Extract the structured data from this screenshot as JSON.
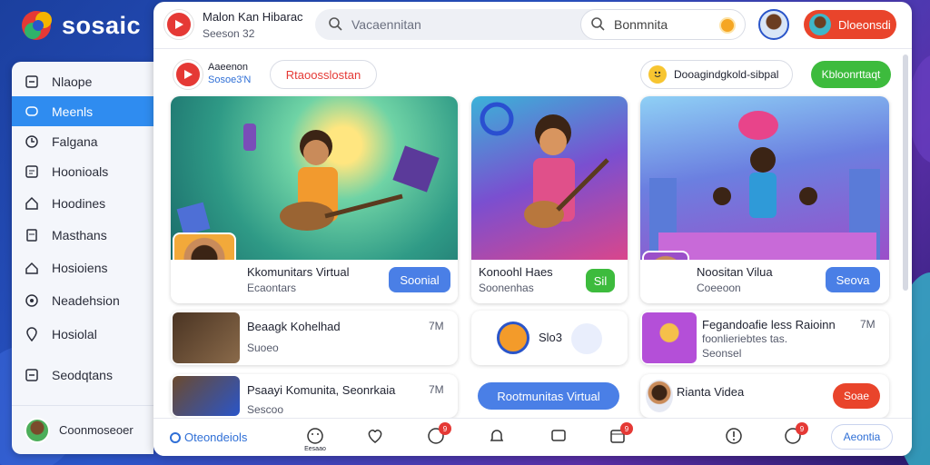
{
  "brand": {
    "name": "sosaic"
  },
  "sidebar": {
    "items": [
      {
        "label": "Nlaope",
        "icon": "inbox-icon"
      },
      {
        "label": "Meenls",
        "icon": "chat-bubble-icon"
      },
      {
        "label": "Falgana",
        "icon": "clock-icon"
      },
      {
        "label": "Hoonioals",
        "icon": "list-icon"
      },
      {
        "label": "Hoodines",
        "icon": "home-icon"
      },
      {
        "label": "Masthans",
        "icon": "document-icon"
      },
      {
        "label": "Hosioiens",
        "icon": "house-icon"
      },
      {
        "label": "Neadehsion",
        "icon": "settings-icon"
      },
      {
        "label": "Hosiolal",
        "icon": "location-pin-icon"
      },
      {
        "label": "Seodqtans",
        "icon": "minus-box-icon"
      }
    ],
    "footer_label": "Coonmoseoer"
  },
  "header": {
    "title": "Malon Kan Hibarac",
    "subtitle": "Seeson 32",
    "search_placeholder": "Vacaennitan",
    "search2_placeholder": "Bonmnita",
    "user_button": "Dloeonsdi"
  },
  "toolbar": {
    "channel_name": "Aaeenon",
    "channel_sub": "Sosoe3'N",
    "tag_label": "Rtaoosslostan",
    "status_text": "Dooagindgkold-sibpal",
    "action_label": "Kbloonrttaqt"
  },
  "cards": [
    {
      "title": "Kkomunitars Virtual",
      "subtitle": "Ecaontars",
      "button": "Soonial"
    },
    {
      "title": "Konoohl Haes",
      "subtitle": "Soonenhas",
      "button": "Sil"
    },
    {
      "title": "Noositan Vilua",
      "subtitle": "Coeeoon",
      "button": "Seova"
    }
  ],
  "rows": [
    {
      "title": "Beaagk Kohelhad",
      "subtitle": "Suoeo",
      "count": "7M"
    },
    {
      "title": "Slo3",
      "subtitle": "",
      "count": ""
    },
    {
      "title": "Fegandoafie less Raioinn",
      "subtitle": "foonlieriebtes tas.",
      "extra": "Seonsel",
      "count": "7M"
    },
    {
      "title": "Psaayi Komunita, Seonrkaia",
      "subtitle": "Sescoo",
      "count": "7M"
    },
    {
      "title": "Rootmunitas Virtual",
      "subtitle": "",
      "count": ""
    },
    {
      "title": "Rianta Videa",
      "subtitle": "",
      "button": "Soae"
    }
  ],
  "bottom_nav": {
    "left_label": "Oteondeiols",
    "home_label": "Eesaao",
    "right_label": "Aeontia",
    "badges": [
      "9",
      "9",
      "9"
    ]
  },
  "colors": {
    "accent": "#2f8cf0",
    "red": "#e9442b",
    "green": "#3dbb3d",
    "blue_btn": "#4a7fe6"
  }
}
